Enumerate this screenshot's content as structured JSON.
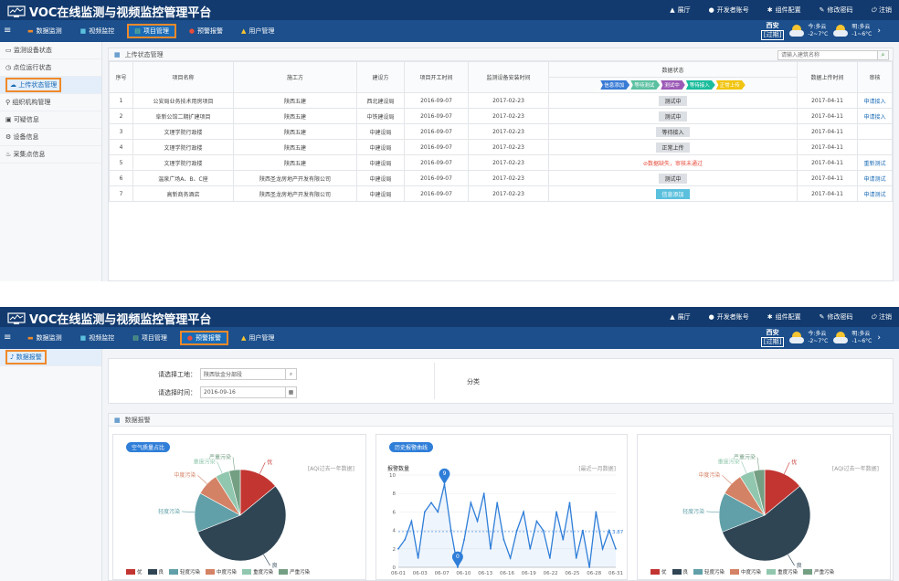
{
  "app": {
    "title": "VOC在线监测与视频监控管理平台",
    "top_links": [
      "展厅",
      "开发者账号",
      "组件配置",
      "修改密码",
      "注销"
    ],
    "menu": [
      "数据监测",
      "视频监控",
      "项目管理",
      "预警报警",
      "用户管理"
    ],
    "weather": {
      "city": "西安",
      "tag": "[过期]",
      "today": "今:多云",
      "today_temp": "-2~7°C",
      "tomorrow": "明:多云",
      "tomorrow_temp": "-1~6°C"
    }
  },
  "s1": {
    "sidebar": [
      "监测设备状态",
      "点位运行状态",
      "上传状态管理",
      "组织机构管理",
      "可疑信息",
      "设备信息",
      "采集点信息"
    ],
    "panel_title": "上传状态管理",
    "search_placeholder": "请输入建筑名称",
    "columns": [
      "序号",
      "项目名称",
      "施工方",
      "建设方",
      "项目开工时间",
      "监测设备安装时间",
      "数据状态",
      "数据上传时间",
      "审核"
    ],
    "flow": [
      {
        "t": "信息添加",
        "c": "#3a7bd5"
      },
      {
        "t": "等待测试",
        "c": "#5bc0a0"
      },
      {
        "t": "测试中",
        "c": "#9b59b6"
      },
      {
        "t": "等待接入",
        "c": "#1abc9c"
      },
      {
        "t": "正常上传",
        "c": "#f1c40f"
      }
    ],
    "rows": [
      {
        "no": "1",
        "name": "公安局业务技术用房项目",
        "builder": "陕西五建",
        "owner": "西北建设局",
        "start": "2016-09-07",
        "install": "2017-02-23",
        "status": "测试中",
        "skind": "btn",
        "upload": "2017-04-11",
        "audit": "申请接入"
      },
      {
        "no": "2",
        "name": "阜新公馆二期扩建项目",
        "builder": "陕西五建",
        "owner": "中铁建设局",
        "start": "2016-09-07",
        "install": "2017-02-23",
        "status": "测试中",
        "skind": "btn",
        "upload": "2017-04-11",
        "audit": "申请接入"
      },
      {
        "no": "3",
        "name": "文理学院行政楼",
        "builder": "陕西五建",
        "owner": "中建设局",
        "start": "2016-09-07",
        "install": "2017-02-23",
        "status": "等待接入",
        "skind": "btn",
        "upload": "2017-04-11",
        "audit": ""
      },
      {
        "no": "4",
        "name": "文理学院行政楼",
        "builder": "陕西五建",
        "owner": "中建设局",
        "start": "2016-09-07",
        "install": "2017-02-23",
        "status": "正常上传",
        "skind": "btn",
        "upload": "2017-04-11",
        "audit": ""
      },
      {
        "no": "5",
        "name": "文理学院行政楼",
        "builder": "陕西五建",
        "owner": "中建设局",
        "start": "2016-09-07",
        "install": "2017-02-23",
        "status": "⊘数据缺失，审核未通过",
        "skind": "red",
        "upload": "2017-04-11",
        "audit": "重新测试"
      },
      {
        "no": "6",
        "name": "温泉广场A、B、C座",
        "builder": "陕西圣龙房地产开发有限公司",
        "owner": "中建设局",
        "start": "2016-09-07",
        "install": "2017-02-23",
        "status": "测试中",
        "skind": "btn",
        "upload": "2017-04-11",
        "audit": "申请测试"
      },
      {
        "no": "7",
        "name": "高新商务酒店",
        "builder": "陕西圣龙房地产开发有限公司",
        "owner": "中建设局",
        "start": "2016-09-07",
        "install": "2017-02-23",
        "status": "信息添加",
        "skind": "blue",
        "upload": "2017-04-11",
        "audit": "申请测试"
      }
    ]
  },
  "s2": {
    "sidebar": [
      "数据报警"
    ],
    "form": {
      "site_label": "请选择工地：",
      "site_value": "陕西钛金分部段",
      "date_label": "请选择时间：",
      "date_value": "2016-09-16",
      "group_label": "分类"
    },
    "panel_title": "数据报警",
    "pie_title": "空气质量占比",
    "pie_note": "[AQI过去一年数据]",
    "line_title": "历史报警曲线",
    "line_note": "[最近一月数据]",
    "line_ylabel": "报警数量",
    "avg_label": "3.87",
    "colors": {
      "accent": "#2f7ed8",
      "orange": "#f0892a",
      "header": "#123a6e"
    }
  },
  "chart_data": [
    {
      "type": "pie",
      "title": "空气质量占比",
      "labels": [
        "优",
        "良",
        "轻度污染",
        "中度污染",
        "重度污染",
        "严重污染"
      ],
      "values": [
        14,
        55,
        14,
        8,
        5,
        4
      ],
      "colors": [
        "#c23531",
        "#2f4554",
        "#61a0a8",
        "#d48265",
        "#91c7ae",
        "#749f83"
      ]
    },
    {
      "type": "line",
      "title": "历史报警曲线",
      "ylabel": "报警数量",
      "ylim": [
        0,
        10
      ],
      "yticks": [
        0,
        2,
        4,
        6,
        8,
        10
      ],
      "xticks": [
        "06-01",
        "06-03",
        "06-07",
        "06-10",
        "06-13",
        "06-16",
        "06-19",
        "06-22",
        "06-25",
        "06-28",
        "06-31"
      ],
      "values": [
        2,
        3,
        5,
        1,
        6,
        7,
        6,
        9,
        4,
        0,
        3,
        7,
        5,
        8,
        2,
        7,
        3,
        1,
        4,
        6,
        2,
        5,
        4,
        1,
        6,
        3,
        7,
        1,
        4,
        0,
        6,
        2,
        4,
        2
      ],
      "markpoints": [
        {
          "index": 7,
          "value": "9"
        },
        {
          "index": 9,
          "value": "0"
        }
      ],
      "average": 3.87
    },
    {
      "type": "pie",
      "title": "空气质量占比",
      "labels": [
        "优",
        "良",
        "轻度污染",
        "中度污染",
        "重度污染",
        "严重污染"
      ],
      "values": [
        14,
        55,
        14,
        8,
        5,
        4
      ],
      "colors": [
        "#c23531",
        "#2f4554",
        "#61a0a8",
        "#d48265",
        "#91c7ae",
        "#749f83"
      ]
    }
  ]
}
